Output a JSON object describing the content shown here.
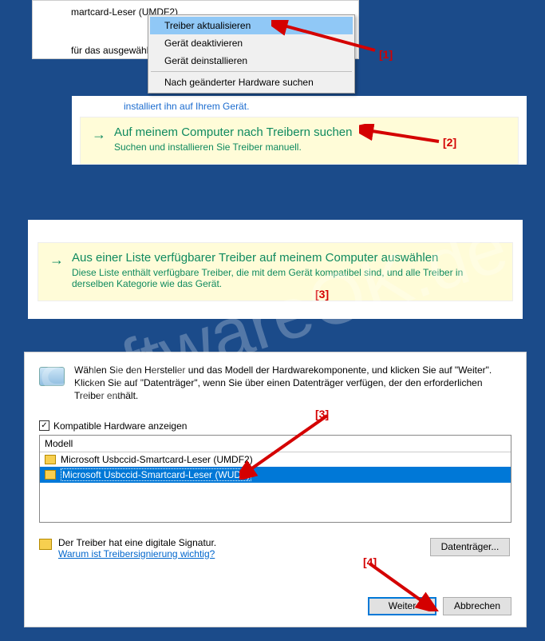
{
  "watermark": "SoftwareOK.de",
  "panel1": {
    "device_label": "martcard-Leser (UMDF2)",
    "subtext": "für das ausgewählte G",
    "menu": {
      "update": "Treiber aktualisieren",
      "disable": "Gerät deaktivieren",
      "uninstall": "Gerät deinstallieren",
      "scan": "Nach geänderter Hardware suchen"
    }
  },
  "panel2": {
    "toptext": "installiert ihn auf Ihrem Gerät.",
    "opt_title": "Auf meinem Computer nach Treibern suchen",
    "opt_desc": "Suchen und installieren Sie Treiber manuell."
  },
  "panel3": {
    "opt_title": "Aus einer Liste verfügbarer Treiber auf meinem Computer auswählen",
    "opt_desc": "Diese Liste enthält verfügbare Treiber, die mit dem Gerät kompatibel sind, und alle Treiber in derselben Kategorie wie das Gerät."
  },
  "panel4": {
    "instructions": "Wählen Sie den Hersteller und das Modell der Hardwarekomponente, und klicken Sie auf \"Weiter\". Klicken Sie auf \"Datenträger\", wenn Sie über einen Datenträger verfügen, der den erforderlichen Treiber enthält.",
    "compat_label": "Kompatible Hardware anzeigen",
    "model_header": "Modell",
    "models": {
      "m1": "Microsoft Usbccid-Smartcard-Leser (UMDF2)",
      "m2": "Microsoft Usbccid-Smartcard-Leser (WUDF)"
    },
    "sig_text": "Der Treiber hat eine digitale Signatur.",
    "sig_link": "Warum ist Treibersignierung wichtig?",
    "disk_btn": "Datenträger...",
    "next_btn": "Weiter",
    "cancel_btn": "Abbrechen"
  },
  "annotations": {
    "a1": "[1]",
    "a2": "[2]",
    "a3": "[3]",
    "a3b": "[3]",
    "a4": "[4]"
  }
}
